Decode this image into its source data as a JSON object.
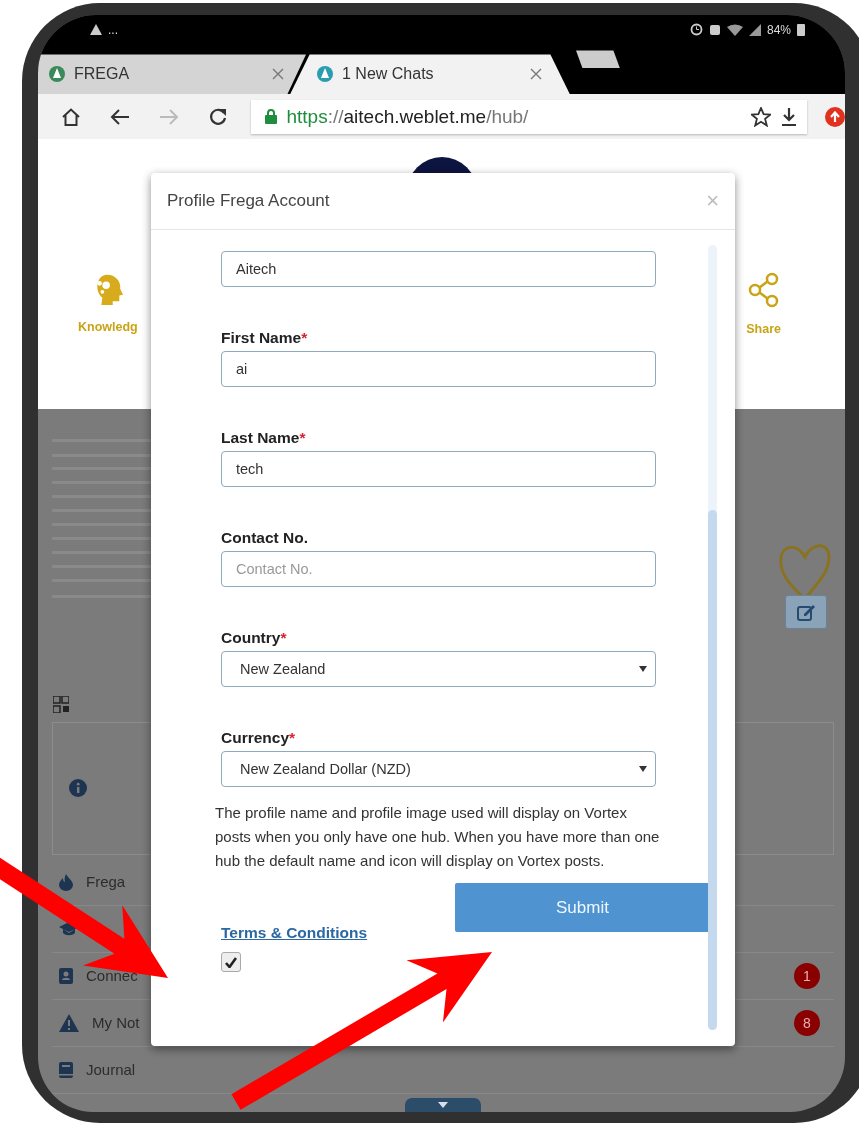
{
  "status_bar": {
    "notifications": "...",
    "battery": "84%"
  },
  "browser": {
    "tabs": [
      {
        "title": "FREGA",
        "selected": false
      },
      {
        "title": "1 New Chats",
        "selected": true
      }
    ],
    "nav": [
      {
        "kind": "home",
        "disabled": false
      },
      {
        "kind": "back",
        "disabled": false
      },
      {
        "kind": "forward",
        "disabled": true
      },
      {
        "kind": "reload",
        "disabled": false
      }
    ],
    "url": {
      "scheme": "https",
      "separator": "://",
      "host": "aitech.weblet.me",
      "path": "/hub/"
    }
  },
  "page": {
    "actions": [
      {
        "kind": "knowledge",
        "label": "Knowledg"
      },
      {
        "kind": "share",
        "label": "Share"
      }
    ],
    "menu": [
      {
        "kind": "frega",
        "label": "Frega"
      },
      {
        "kind": "learn"
      },
      {
        "kind": "contacts",
        "label": "Connec",
        "badge": "1"
      },
      {
        "kind": "alert",
        "label": "My Not",
        "badge": "8"
      },
      {
        "kind": "journal",
        "label": "Journal"
      }
    ]
  },
  "modal": {
    "title": "Profile Frega Account",
    "close": "×",
    "fields": [
      {
        "kind": "text",
        "value": "Aitech"
      },
      {
        "kind": "text",
        "label": "First Name",
        "required_mark": "*",
        "value": "ai"
      },
      {
        "kind": "text",
        "label": "Last Name",
        "required_mark": "*",
        "value": "tech"
      },
      {
        "kind": "text",
        "label": "Contact No.",
        "placeholder": "Contact No."
      },
      {
        "kind": "select",
        "label": "Country",
        "required_mark": "*",
        "value": "New Zealand"
      },
      {
        "kind": "select",
        "label": "Currency",
        "required_mark": "*",
        "value": "New Zealand Dollar (NZD)"
      }
    ],
    "note": "The profile name and profile image used will display on Vortex posts when you only have one hub. When you have more than one hub the default name and icon will display on Vortex posts.",
    "submit": "Submit",
    "terms_link": "Terms & Conditions",
    "terms_checked": true
  }
}
